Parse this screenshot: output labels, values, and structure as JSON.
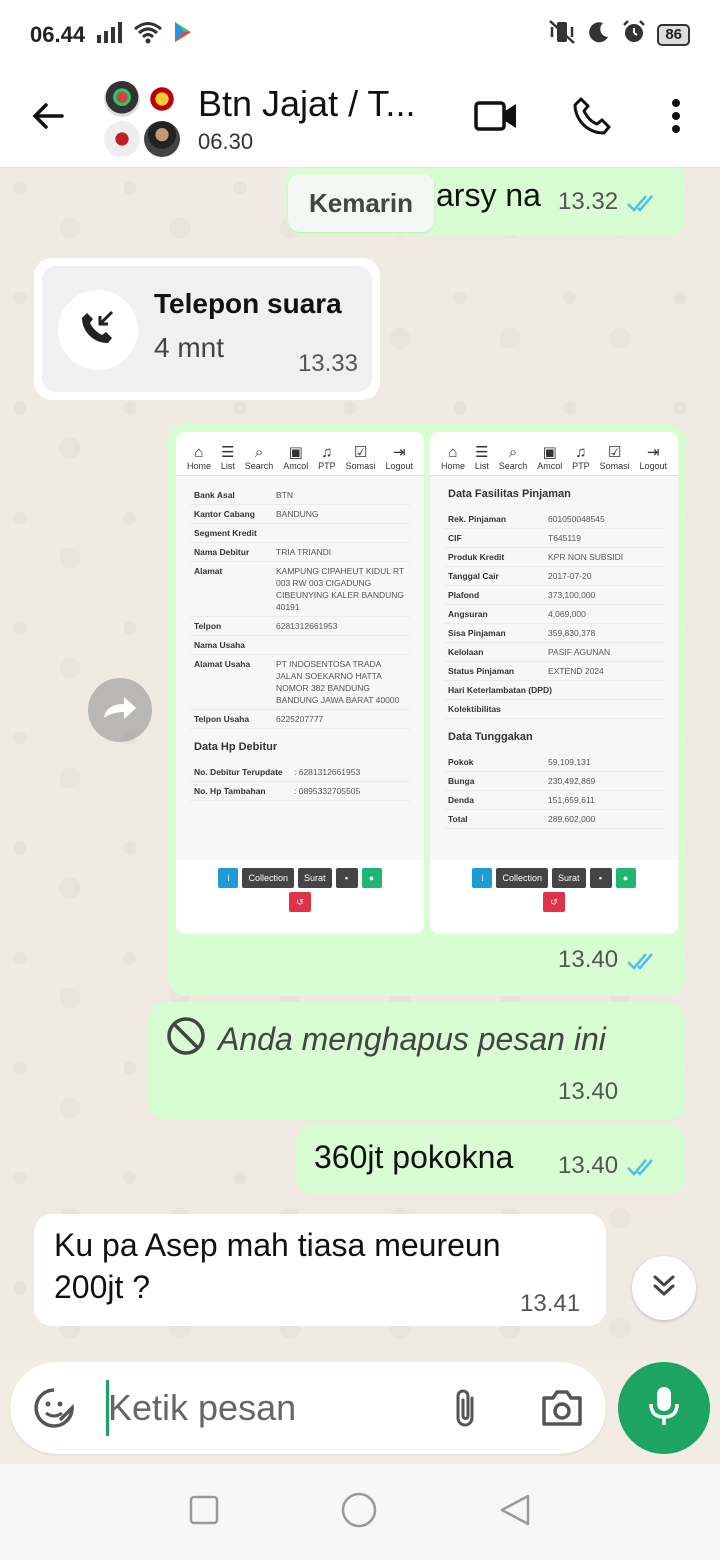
{
  "status_bar": {
    "time": "06.44",
    "battery": "86",
    "icons": [
      "signal-icon",
      "wifi-icon",
      "play-games-icon",
      "vibrate-icon",
      "moon-icon",
      "alarm-icon"
    ]
  },
  "header": {
    "title": "Btn Jajat / T...",
    "subtitle": "06.30",
    "icons": [
      "back-arrow-icon",
      "video-call-icon",
      "phone-icon",
      "more-vert-icon"
    ]
  },
  "chat": {
    "date_chip": "Kemarin",
    "messages": [
      {
        "type": "text",
        "direction": "out",
        "text": "arsy na",
        "time": "13.32",
        "read": true
      },
      {
        "type": "call",
        "direction": "in",
        "title": "Telepon suara",
        "duration": "4 mnt",
        "time": "13.33"
      },
      {
        "type": "images",
        "direction": "out",
        "time": "13.40",
        "read": true
      },
      {
        "type": "deleted",
        "direction": "out",
        "text": "Anda menghapus pesan ini",
        "time": "13.40"
      },
      {
        "type": "text",
        "direction": "out",
        "text": "360jt pokokna",
        "time": "13.40",
        "read": true
      },
      {
        "type": "text",
        "direction": "in",
        "text": "Ku pa Asep mah tiasa meureun 200jt ?",
        "time": "13.41"
      }
    ]
  },
  "screenshot_nav": [
    "Home",
    "List",
    "Search",
    "Amcol",
    "PTP",
    "Somasi",
    "Logout"
  ],
  "screenshot_buttons": {
    "info": "i",
    "collection": "Collection",
    "surat": "Surat"
  },
  "screenshot_left": {
    "rows": [
      {
        "k": "Bank Asal",
        "v": "BTN"
      },
      {
        "k": "Kantor Cabang",
        "v": "BANDUNG"
      },
      {
        "k": "Segment Kredit",
        "v": ""
      },
      {
        "k": "Nama Debitur",
        "v": "TRIA TRIANDI"
      },
      {
        "k": "Alamat",
        "v": "KAMPUNG CIPAHEUT KIDUL RT 003 RW 003 CIGADUNG CIBEUNYING KALER BANDUNG 40191"
      },
      {
        "k": "Telpon",
        "v": "6281312661953"
      },
      {
        "k": "Nama Usaha",
        "v": ""
      },
      {
        "k": "Alamat Usaha",
        "v": "PT INDOSENTOSA TRADA JALAN SOEKARNO HATTA NOMOR 382 BANDUNG BANDUNG JAWA BARAT 40000"
      },
      {
        "k": "Telpon Usaha",
        "v": "6225207777"
      }
    ],
    "section": "Data Hp Debitur",
    "hp_rows": [
      {
        "k": "No. Debitur Terupdate",
        "v": ": 6281312661953"
      },
      {
        "k": "No. Hp Tambahan",
        "v": ": 0895332705505"
      }
    ]
  },
  "screenshot_right": {
    "section1": "Data Fasilitas Pinjaman",
    "rows1": [
      {
        "k": "Rek. Pinjaman",
        "v": "601050048545"
      },
      {
        "k": "CIF",
        "v": "T645119"
      },
      {
        "k": "Produk Kredit",
        "v": "KPR NON SUBSIDI"
      },
      {
        "k": "Tanggal Cair",
        "v": "2017-07-20"
      },
      {
        "k": "Plafond",
        "v": "373,100,000"
      },
      {
        "k": "Angsuran",
        "v": "4,069,000"
      },
      {
        "k": "Sisa Pinjaman",
        "v": "359,830,378"
      },
      {
        "k": "Kelolaan",
        "v": "PASIF AGUNAN"
      },
      {
        "k": "Status Pinjaman",
        "v": "EXTEND 2024"
      },
      {
        "k": "Hari Keterlambatan (DPD)",
        "v": ""
      },
      {
        "k": "Kolektibilitas",
        "v": ""
      }
    ],
    "section2": "Data Tunggakan",
    "rows2": [
      {
        "k": "Pokok",
        "v": "59,109,131"
      },
      {
        "k": "Bunga",
        "v": "230,492,869"
      },
      {
        "k": "Denda",
        "v": "151,659,611"
      },
      {
        "k": "Total",
        "v": "289,602,000"
      }
    ]
  },
  "input_bar": {
    "placeholder": "Ketik pesan",
    "icons": [
      "sticker-icon",
      "attach-icon",
      "camera-icon",
      "mic-icon"
    ]
  },
  "nav_bar": {
    "icons": [
      "recents-icon",
      "home-icon",
      "back-icon"
    ]
  },
  "colors": {
    "accent": "#1da462",
    "outgoing_bubble": "#d9fdd3",
    "incoming_bubble": "#ffffff",
    "read_ticks": "#53bdeb",
    "chat_background": "#efeae2"
  }
}
